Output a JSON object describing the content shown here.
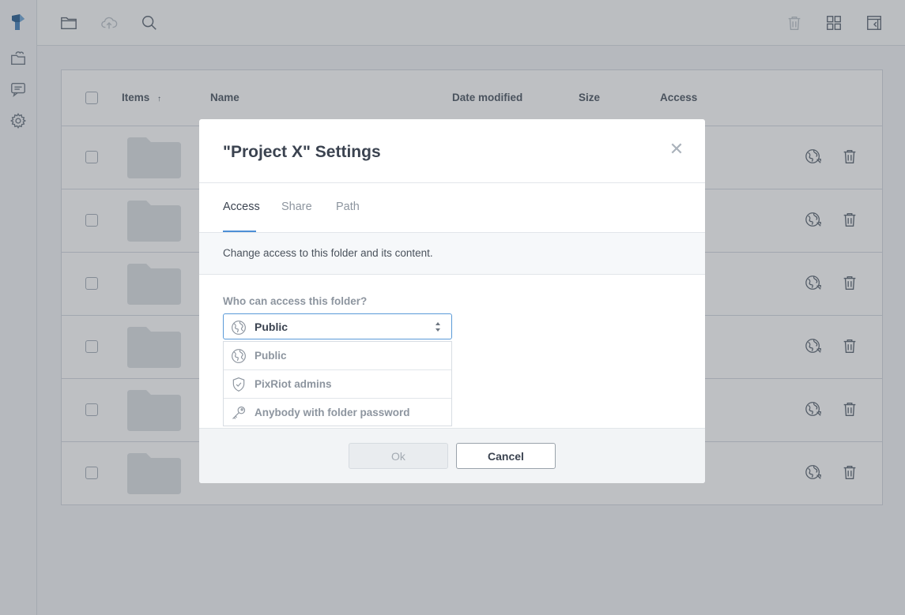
{
  "sidebar": {
    "items": [
      {
        "icon": "logo-icon"
      },
      {
        "icon": "cloud-folder-icon"
      },
      {
        "icon": "chat-icon"
      },
      {
        "icon": "gear-icon"
      }
    ]
  },
  "toolbar": {
    "left": [
      {
        "icon": "folder-icon"
      },
      {
        "icon": "cloud-upload-icon"
      },
      {
        "icon": "search-icon"
      }
    ],
    "right": [
      {
        "icon": "trash-icon"
      },
      {
        "icon": "grid-view-icon"
      },
      {
        "icon": "panel-icon"
      }
    ]
  },
  "table": {
    "columns": {
      "items": "Items",
      "name": "Name",
      "date_modified": "Date modified",
      "size": "Size",
      "access": "Access"
    },
    "sort_indicator": "↑",
    "row_count": 6
  },
  "modal": {
    "title": "\"Project X\" Settings",
    "close_symbol": "✕",
    "tabs": [
      "Access",
      "Share",
      "Path"
    ],
    "active_tab": "Access",
    "description": "Change access to this folder and its content.",
    "question": "Who can access this folder?",
    "select_value": "Public",
    "options": [
      {
        "label": "Public",
        "icon": "globe-icon"
      },
      {
        "label": "PixRiot admins",
        "icon": "shield-icon"
      },
      {
        "label": "Anybody with folder password",
        "icon": "key-icon"
      }
    ],
    "ok_label": "Ok",
    "cancel_label": "Cancel"
  },
  "colors": {
    "accent": "#4d8fd6",
    "overlay": "#141c26"
  }
}
